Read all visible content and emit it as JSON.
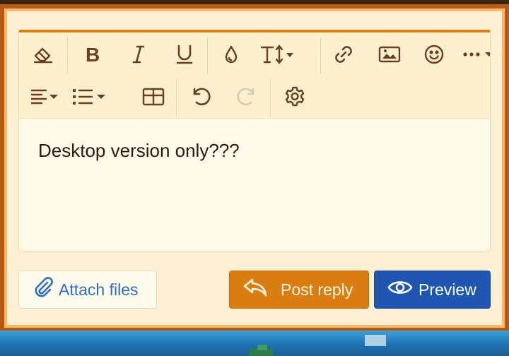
{
  "editor": {
    "content": "Desktop version only???",
    "toolbar": {
      "row1": [
        {
          "name": "eraser-icon",
          "label": "Remove formatting"
        },
        {
          "name": "bold-icon",
          "label": "B"
        },
        {
          "name": "italic-icon",
          "label": "I"
        },
        {
          "name": "underline-icon",
          "label": "U"
        },
        {
          "name": "text-color-icon",
          "label": "Text color"
        },
        {
          "name": "font-size-icon",
          "label": "T↕"
        },
        {
          "name": "link-icon",
          "label": "Insert link"
        },
        {
          "name": "image-icon",
          "label": "Insert image"
        },
        {
          "name": "smiley-icon",
          "label": "Smilies"
        },
        {
          "name": "more-options-icon",
          "label": "More options"
        }
      ],
      "row2": [
        {
          "name": "align-icon",
          "label": "Alignment"
        },
        {
          "name": "list-icon",
          "label": "List"
        },
        {
          "name": "table-icon",
          "label": "Insert table"
        },
        {
          "name": "undo-icon",
          "label": "Undo"
        },
        {
          "name": "redo-icon",
          "label": "Redo",
          "disabled": true
        },
        {
          "name": "settings-icon",
          "label": "Toggle BB code"
        }
      ]
    }
  },
  "actions": {
    "attach_label": "Attach files",
    "post_label": "Post reply",
    "preview_label": "Preview"
  },
  "colors": {
    "accent": "#da7d12",
    "primary": "#1f56b1",
    "link": "#2c6dc7",
    "frame": "#b85a12",
    "panel": "#fdf0d4"
  }
}
